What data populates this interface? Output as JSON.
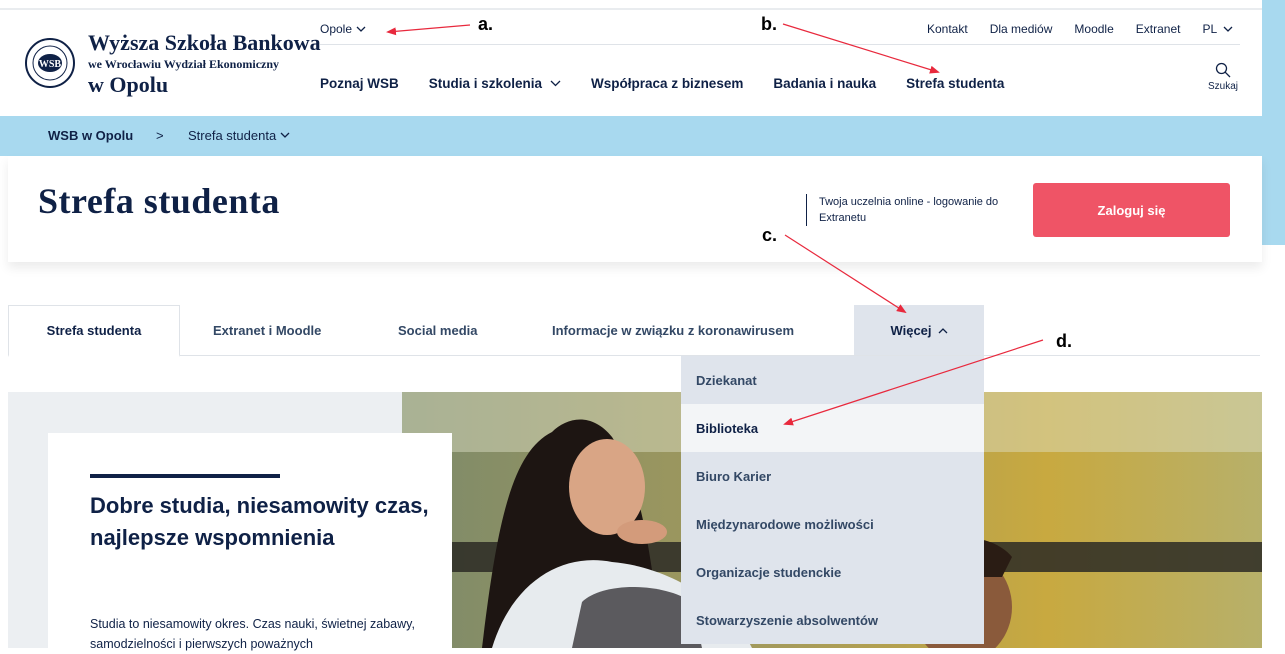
{
  "logo": {
    "line1": "Wyższa Szkoła Bankowa",
    "line2": "we Wrocławiu Wydział Ekonomiczny",
    "line3": "w Opolu",
    "seal_text": "WSB"
  },
  "city_selector": {
    "value": "Opole"
  },
  "top_links": [
    "Kontakt",
    "Dla mediów",
    "Moodle",
    "Extranet",
    "PL"
  ],
  "main_nav": {
    "items": [
      "Poznaj WSB",
      "Studia i szkolenia",
      "Współpraca z biznesem",
      "Badania i nauka",
      "Strefa studenta"
    ],
    "search_label": "Szukaj"
  },
  "breadcrumb": {
    "home": "WSB w Opolu",
    "separator": ">",
    "current": "Strefa studenta"
  },
  "header": {
    "title": "Strefa studenta",
    "login_info": "Twoja uczelnia online - logowanie do Extranetu",
    "login_button": "Zaloguj się"
  },
  "tabs": [
    "Strefa studenta",
    "Extranet i Moodle",
    "Social media",
    "Informacje w związku z koronawirusem",
    "Więcej"
  ],
  "dropdown": {
    "items": [
      "Dziekanat",
      "Biblioteka",
      "Biuro Karier",
      "Międzynarodowe możliwości",
      "Organizacje studenckie",
      "Stowarzyszenie absolwentów"
    ],
    "hovered": "Biblioteka"
  },
  "hero": {
    "heading": "Dobre studia, niesamowity czas, najlepsze wspomnienia",
    "text": "Studia to niesamowity okres. Czas nauki, świetnej zabawy, samodzielności i pierwszych poważnych"
  },
  "annotations": {
    "a": "a.",
    "b": "b.",
    "c": "c.",
    "d": "d."
  },
  "colors": {
    "navy": "#0f2146",
    "light_blue": "#a8d9ef",
    "accent_red": "#ef5466",
    "arrow_red": "#e8293d"
  }
}
